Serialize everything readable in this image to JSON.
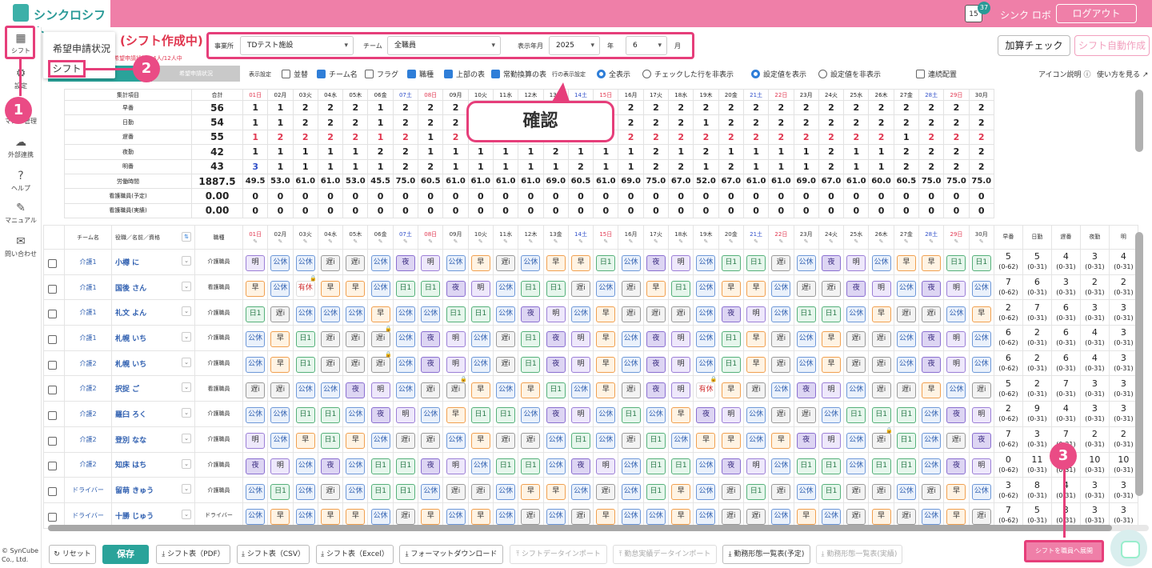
{
  "header": {
    "logo_text": "シンクロシフト",
    "notif_day": "15",
    "notif_count": "37",
    "user_name": "シンク ロボ",
    "logout_label": "ログアウト"
  },
  "sidebar": {
    "items": [
      {
        "label": "シフト",
        "icon": "calendar-icon",
        "glyph": "▦"
      },
      {
        "label": "設定",
        "icon": "gear-icon",
        "glyph": "⚙"
      },
      {
        "label": "マスタ管理",
        "icon": "database-icon",
        "glyph": "≣"
      },
      {
        "label": "外部連携",
        "icon": "cloud-icon",
        "glyph": "☁"
      },
      {
        "label": "ヘルプ",
        "icon": "help-icon",
        "glyph": "?"
      },
      {
        "label": "マニュアル",
        "icon": "pencil-icon",
        "glyph": "✎"
      },
      {
        "label": "問い合わせ",
        "icon": "mail-icon",
        "glyph": "✉"
      }
    ],
    "copyright_1": "© SynCube",
    "copyright_2": "Co., Ltd."
  },
  "popup": {
    "item1": "希望申請状況",
    "item2": "シフト"
  },
  "page_title": "(シフト作成中)",
  "page_subtitle": "希望申請状況：4人/12人中",
  "filters": {
    "office_label": "事業所",
    "office_value": "TDテスト施設",
    "team_label": "チーム",
    "team_value": "全職員",
    "month_label": "表示年月",
    "year_value": "2025",
    "year_unit": "年",
    "month_value": "6",
    "month_unit": "月"
  },
  "actions": {
    "check": "加算チェック",
    "auto": "シフト自動作成"
  },
  "tabs": {
    "tab2": "希望申請状況"
  },
  "options": {
    "display_label": "表示設定",
    "cb": [
      {
        "label": "並替",
        "on": false
      },
      {
        "label": "チーム名",
        "on": true
      },
      {
        "label": "フラグ",
        "on": false
      },
      {
        "label": "職種",
        "on": true
      },
      {
        "label": "上部の表",
        "on": true
      },
      {
        "label": "常勤換算の表",
        "on": true
      }
    ],
    "row_label": "行の表示設定",
    "rows": [
      {
        "label": "全表示",
        "on": true
      },
      {
        "label": "チェックした行を非表示",
        "on": false
      }
    ],
    "vals": [
      {
        "label": "設定値を表示",
        "on": true
      },
      {
        "label": "設定値を非表示",
        "on": false
      }
    ],
    "consec": "連続配置",
    "icon_help": "アイコン説明",
    "how_to": "使い方を見る"
  },
  "callouts": {
    "confirm": "確認",
    "b1": "1",
    "b2": "2",
    "b3": "3"
  },
  "days": [
    "01日",
    "02月",
    "03火",
    "04水",
    "05木",
    "06金",
    "07土",
    "08日",
    "09月",
    "10火",
    "11水",
    "12木",
    "13金",
    "14土",
    "15日",
    "16月",
    "17火",
    "18水",
    "19木",
    "20金",
    "21土",
    "22日",
    "23月",
    "24火",
    "25水",
    "26木",
    "27金",
    "28土",
    "29日",
    "30月"
  ],
  "summary": {
    "head_label": "集計項目",
    "head_total": "合計",
    "rows": [
      {
        "label": "早番",
        "total": "56",
        "vals": [
          "1",
          "1",
          "2",
          "2",
          "2",
          "1",
          "2",
          "2",
          "2",
          "",
          "",
          "",
          "",
          "",
          "",
          "2",
          "2",
          "2",
          "2",
          "2",
          "2",
          "2",
          "2",
          "2",
          "2",
          "2",
          "2",
          "2",
          "2",
          "2"
        ]
      },
      {
        "label": "日勤",
        "total": "54",
        "vals": [
          "1",
          "1",
          "2",
          "2",
          "2",
          "1",
          "2",
          "2",
          "2",
          "",
          "",
          "",
          "",
          "",
          "",
          "2",
          "2",
          "2",
          "1",
          "2",
          "2",
          "2",
          "2",
          "2",
          "2",
          "2",
          "2",
          "2",
          "2",
          "2"
        ]
      },
      {
        "label": "遅番",
        "total": "55",
        "vals": [
          "1",
          "2",
          "2",
          "2",
          "2",
          "1",
          "2",
          "1",
          "2",
          "",
          "",
          "",
          "",
          "",
          "",
          "2",
          "2",
          "2",
          "2",
          "2",
          "2",
          "2",
          "2",
          "2",
          "2",
          "2",
          "1",
          "2",
          "2",
          "2"
        ],
        "color": "red"
      },
      {
        "label": "夜勤",
        "total": "42",
        "vals": [
          "1",
          "1",
          "1",
          "1",
          "1",
          "2",
          "2",
          "1",
          "1",
          "1",
          "1",
          "1",
          "2",
          "1",
          "1",
          "1",
          "2",
          "1",
          "2",
          "1",
          "1",
          "1",
          "1",
          "2",
          "1",
          "1",
          "2",
          "2",
          "2",
          "2"
        ]
      },
      {
        "label": "明番",
        "total": "43",
        "vals": [
          "3",
          "1",
          "1",
          "1",
          "1",
          "1",
          "2",
          "2",
          "1",
          "1",
          "1",
          "1",
          "1",
          "2",
          "1",
          "1",
          "2",
          "2",
          "1",
          "2",
          "1",
          "1",
          "1",
          "2",
          "1",
          "1",
          "2",
          "2",
          "2",
          "2"
        ],
        "first_blue": true
      },
      {
        "label": "労働時間",
        "total": "1887.5",
        "vals": [
          "49.5",
          "53.0",
          "61.0",
          "61.0",
          "53.0",
          "45.5",
          "75.0",
          "60.5",
          "61.0",
          "61.0",
          "61.0",
          "61.0",
          "69.0",
          "60.5",
          "61.0",
          "69.0",
          "75.0",
          "67.0",
          "52.0",
          "67.0",
          "61.0",
          "61.0",
          "69.0",
          "67.0",
          "61.0",
          "60.0",
          "60.5",
          "75.0",
          "75.0",
          "75.0"
        ]
      },
      {
        "label": "看護職員(予定)",
        "total": "0.00",
        "vals": [
          "0",
          "0",
          "0",
          "0",
          "0",
          "0",
          "0",
          "0",
          "0",
          "0",
          "0",
          "0",
          "0",
          "0",
          "0",
          "0",
          "0",
          "0",
          "0",
          "0",
          "0",
          "0",
          "0",
          "0",
          "0",
          "0",
          "0",
          "0",
          "0",
          "0"
        ]
      },
      {
        "label": "看護職員(実績)",
        "total": "0.00",
        "vals": [
          "0",
          "0",
          "0",
          "0",
          "0",
          "0",
          "0",
          "0",
          "0",
          "0",
          "0",
          "0",
          "0",
          "0",
          "0",
          "0",
          "0",
          "0",
          "0",
          "0",
          "0",
          "0",
          "0",
          "0",
          "0",
          "0",
          "0",
          "0",
          "0",
          "0"
        ]
      }
    ]
  },
  "grid": {
    "head": {
      "team": "チーム名",
      "name": "役職／名前／資格",
      "job": "職種"
    },
    "stats_head": [
      "早番",
      "日勤",
      "遅番",
      "夜勤",
      "明"
    ],
    "rows": [
      {
        "team": "介護1",
        "name": "小樽 に",
        "job": "介護職員",
        "shifts": [
          "明",
          "公休",
          "公休",
          "遅i",
          "遅i",
          "公休",
          "夜",
          "明",
          "公休",
          "早",
          "遅i",
          "公休",
          "早",
          "早",
          "日1",
          "公休",
          "夜",
          "明",
          "公休",
          "日1",
          "日1",
          "遅i",
          "公休",
          "夜",
          "明",
          "公休",
          "早",
          "早",
          "日1",
          "日1"
        ],
        "stats": [
          [
            "5",
            "(0-62)"
          ],
          [
            "5",
            "(0-31)"
          ],
          [
            "4",
            "(0-31)"
          ],
          [
            "3",
            "(0-31)"
          ],
          [
            "4",
            "(0-31)"
          ]
        ]
      },
      {
        "team": "介護1",
        "name": "国後 さん",
        "job": "看護職員",
        "shifts": [
          "早",
          "公休",
          "有休",
          "早",
          "早",
          "公休",
          "日1",
          "日1",
          "夜",
          "明",
          "公休",
          "日1",
          "日1",
          "遅i",
          "公休",
          "遅i",
          "早",
          "日1",
          "公休",
          "早",
          "早",
          "公休",
          "遅i",
          "遅i",
          "夜",
          "明",
          "公休",
          "夜",
          "明",
          "公休"
        ],
        "stats": [
          [
            "7",
            "(0-62)"
          ],
          [
            "6",
            "(0-31)"
          ],
          [
            "3",
            "(0-31)"
          ],
          [
            "2",
            "(0-31)"
          ],
          [
            "2",
            "(0-31)"
          ]
        ]
      },
      {
        "team": "介護1",
        "name": "礼文 よん",
        "job": "介護職員",
        "shifts": [
          "日1",
          "遅i",
          "公休",
          "公休",
          "公休",
          "早",
          "公休",
          "公休",
          "日1",
          "日1",
          "公休",
          "夜",
          "明",
          "公休",
          "早",
          "遅i",
          "遅i",
          "遅i",
          "公休",
          "夜",
          "明",
          "公休",
          "日1",
          "日1",
          "公休",
          "早",
          "遅i",
          "遅i",
          "公休",
          "早"
        ],
        "stats": [
          [
            "2",
            "(0-62)"
          ],
          [
            "7",
            "(0-31)"
          ],
          [
            "6",
            "(0-31)"
          ],
          [
            "3",
            "(0-31)"
          ],
          [
            "3",
            "(0-31)"
          ]
        ]
      },
      {
        "team": "介護1",
        "name": "札幌 いち",
        "job": "介護職員",
        "shifts": [
          "公休",
          "早",
          "日1",
          "遅i",
          "遅i",
          "遅i",
          "公休",
          "夜",
          "明",
          "公休",
          "遅i",
          "日1",
          "夜",
          "明",
          "早",
          "公休",
          "夜",
          "明",
          "公休",
          "日1",
          "早",
          "遅i",
          "公休",
          "早",
          "遅i",
          "遅i",
          "公休",
          "夜",
          "明",
          "公休"
        ],
        "stats": [
          [
            "6",
            "(0-62)"
          ],
          [
            "2",
            "(0-31)"
          ],
          [
            "6",
            "(0-31)"
          ],
          [
            "4",
            "(0-31)"
          ],
          [
            "3",
            "(0-31)"
          ]
        ]
      },
      {
        "team": "介護2",
        "name": "札幌 いち",
        "job": "介護職員",
        "shifts": [
          "公休",
          "早",
          "日1",
          "遅i",
          "遅i",
          "遅i",
          "公休",
          "夜",
          "明",
          "公休",
          "遅i",
          "日1",
          "夜",
          "明",
          "早",
          "公休",
          "夜",
          "明",
          "公休",
          "日1",
          "早",
          "遅i",
          "公休",
          "早",
          "遅i",
          "遅i",
          "公休",
          "夜",
          "明",
          "公休"
        ],
        "stats": [
          [
            "6",
            "(0-62)"
          ],
          [
            "2",
            "(0-31)"
          ],
          [
            "6",
            "(0-31)"
          ],
          [
            "4",
            "(0-31)"
          ],
          [
            "3",
            "(0-31)"
          ]
        ]
      },
      {
        "team": "介護2",
        "name": "択捉 ご",
        "job": "看護職員",
        "shifts": [
          "遅i",
          "遅i",
          "公休",
          "公休",
          "夜",
          "明",
          "公休",
          "遅i",
          "遅i",
          "早",
          "公休",
          "早",
          "日1",
          "公休",
          "早",
          "遅i",
          "夜",
          "明",
          "有休",
          "早",
          "遅i",
          "公休",
          "夜",
          "明",
          "公休",
          "遅i",
          "遅i",
          "早",
          "公休",
          "遅i"
        ],
        "stats": [
          [
            "5",
            "(0-62)"
          ],
          [
            "2",
            "(0-31)"
          ],
          [
            "7",
            "(0-31)"
          ],
          [
            "3",
            "(0-31)"
          ],
          [
            "3",
            "(0-31)"
          ]
        ]
      },
      {
        "team": "介護2",
        "name": "羅臼 ろく",
        "job": "介護職員",
        "shifts": [
          "公休",
          "公休",
          "日1",
          "日1",
          "公休",
          "夜",
          "明",
          "公休",
          "早",
          "日1",
          "日1",
          "公休",
          "夜",
          "明",
          "公休",
          "日1",
          "公休",
          "早",
          "夜",
          "明",
          "公休",
          "遅i",
          "遅i",
          "公休",
          "日1",
          "日1",
          "日1",
          "公休",
          "夜",
          "明"
        ],
        "stats": [
          [
            "2",
            "(0-62)"
          ],
          [
            "9",
            "(0-31)"
          ],
          [
            "4",
            "(0-31)"
          ],
          [
            "3",
            "(0-31)"
          ],
          [
            "3",
            "(0-31)"
          ]
        ]
      },
      {
        "team": "介護2",
        "name": "登別 なな",
        "job": "介護職員",
        "shifts": [
          "明",
          "公休",
          "早",
          "日1",
          "早",
          "公休",
          "遅i",
          "遅i",
          "公休",
          "早",
          "遅i",
          "遅i",
          "公休",
          "日1",
          "公休",
          "遅i",
          "日1",
          "公休",
          "早",
          "早",
          "公休",
          "早",
          "夜",
          "明",
          "公休",
          "遅i",
          "日1",
          "公休",
          "遅i",
          "夜"
        ],
        "stats": [
          [
            "7",
            "(0-62)"
          ],
          [
            "3",
            "(0-31)"
          ],
          [
            "7",
            "(0-31)"
          ],
          [
            "2",
            "(0-31)"
          ],
          [
            "2",
            "(0-31)"
          ]
        ]
      },
      {
        "team": "介護2",
        "name": "知床 はち",
        "job": "介護職員",
        "shifts": [
          "夜",
          "明",
          "公休",
          "夜",
          "公休",
          "日1",
          "日1",
          "夜",
          "明",
          "公休",
          "日1",
          "日1",
          "公休",
          "夜",
          "明",
          "公休",
          "日1",
          "日1",
          "公休",
          "夜",
          "明",
          "公休",
          "日1",
          "日1",
          "公休",
          "日1",
          "日1",
          "公休",
          "夜",
          "明"
        ],
        "stats": [
          [
            "0",
            "(0-62)"
          ],
          [
            "11",
            "(0-31)"
          ],
          [
            "0",
            "(0-31)"
          ],
          [
            "10",
            "(0-31)"
          ],
          [
            "10",
            "(0-31)"
          ]
        ]
      },
      {
        "team": "ドライバー",
        "name": "留萌 きゅう",
        "job": "介護職員",
        "shifts": [
          "公休",
          "日1",
          "公休",
          "遅i",
          "公休",
          "日1",
          "日1",
          "公休",
          "遅i",
          "遅i",
          "公休",
          "早",
          "早",
          "公休",
          "遅i",
          "公休",
          "日1",
          "早",
          "公休",
          "遅i",
          "日1",
          "遅i",
          "公休",
          "日1",
          "遅i",
          "遅i",
          "公休",
          "遅i",
          "早",
          "公休"
        ],
        "stats": [
          [
            "3",
            "(0-62)"
          ],
          [
            "8",
            "(0-31)"
          ],
          [
            "4",
            "(0-31)"
          ],
          [
            "3",
            "(0-31)"
          ],
          [
            "3",
            "(0-31)"
          ]
        ]
      },
      {
        "team": "ドライバー",
        "name": "十勝 じゅう",
        "job": "ドライバー",
        "shifts": [
          "公休",
          "早",
          "公休",
          "早",
          "早",
          "公休",
          "遅i",
          "早",
          "公休",
          "早",
          "公休",
          "遅i",
          "公休",
          "遅i",
          "早",
          "公休",
          "公休",
          "早",
          "公休",
          "遅i",
          "遅i",
          "公休",
          "早",
          "公休",
          "遅i",
          "早",
          "遅i",
          "公休",
          "早",
          "遅i"
        ],
        "stats": [
          [
            "7",
            "(0-62)"
          ],
          [
            "5",
            "(0-31)"
          ],
          [
            "3",
            "(0-31)"
          ],
          [
            "3",
            "(0-31)"
          ],
          [
            "3",
            "(0-31)"
          ]
        ]
      }
    ],
    "locks": [
      [
        1,
        2
      ],
      [
        3,
        5
      ],
      [
        4,
        5
      ],
      [
        5,
        8
      ],
      [
        5,
        18
      ],
      [
        7,
        25
      ]
    ]
  },
  "footer": {
    "reset": "リセット",
    "save": "保存",
    "pdf": "シフト表（PDF）",
    "csv": "シフト表（CSV）",
    "excel": "シフト表（Excel）",
    "format_dl": "フォーマットダウンロード",
    "data_import": "シフトデータインポート",
    "actual_import": "勤怠実績データインポート",
    "list_plan": "勤務形態一覧表(予定)",
    "list_actual": "勤務形態一覧表(実績)",
    "deploy": "シフトを職員へ展開"
  }
}
